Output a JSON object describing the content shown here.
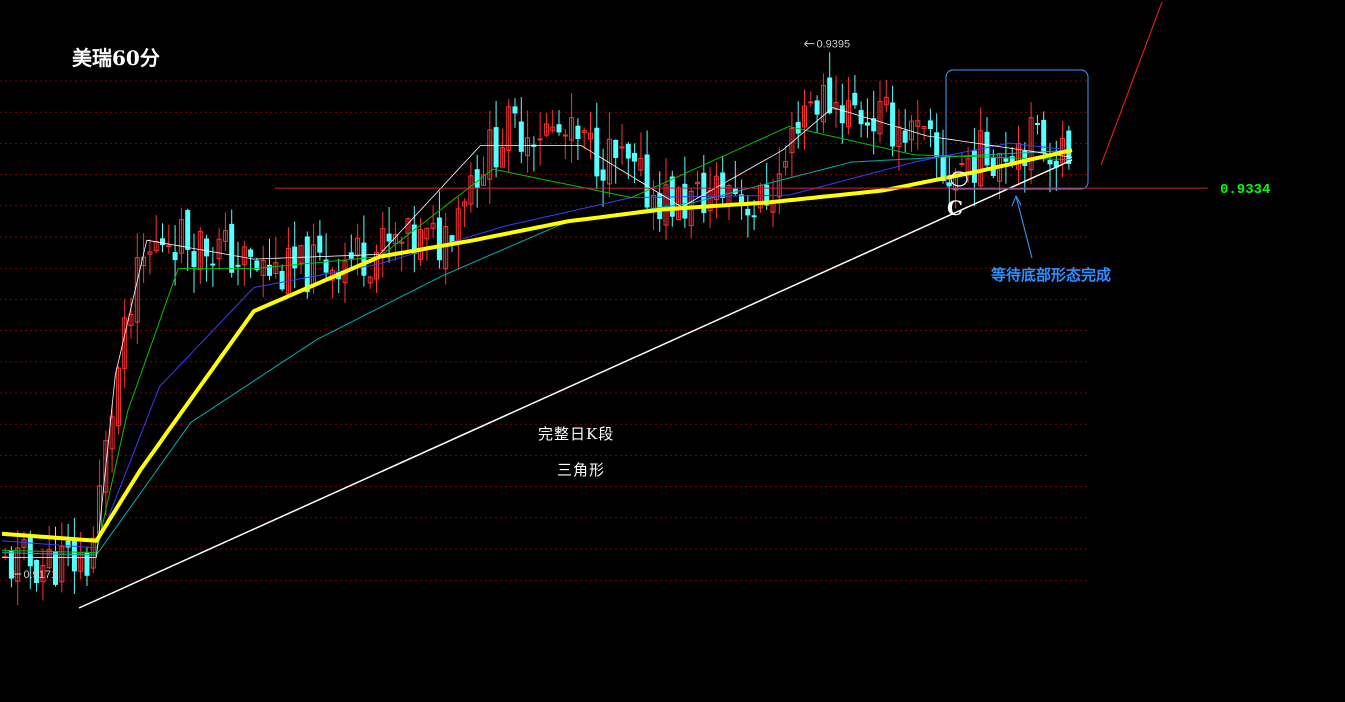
{
  "title": "美瑞60分",
  "annotations": {
    "wait_text": "等待底部形态完成",
    "main_text_1": "完整日K段",
    "main_text_2": "三角形",
    "point_label": "C"
  },
  "colors": {
    "background": "#000000",
    "up_candle": "#ff3030",
    "down_candle": "#54ffff",
    "grid": "#8b0000",
    "ma_main": "#ffff00",
    "ma_blue": "#3a3aff",
    "ma_green": "#00c000",
    "ma_cyan": "#00b0b0",
    "ma_white": "#ffffff",
    "trendline": "#ffffff",
    "level_line": "#cc2244",
    "level_label": "#00ff00",
    "wait_text": "#2e90ff",
    "box": "#3aa0ff",
    "red_line": "#ff2020"
  },
  "chart_data": {
    "type": "candlestick",
    "high_label": "0.9395",
    "low_label": "0.9171",
    "level_label": "0.9334",
    "high_value": 0.9395,
    "low_value": 0.9171,
    "level_value": 0.9334,
    "ylim": [
      0.916,
      0.9405
    ],
    "grid": true,
    "candle_count": 170,
    "close_path": [
      [
        0,
        0.9175
      ],
      [
        14,
        0.9177
      ],
      [
        15,
        0.9195
      ],
      [
        18,
        0.925
      ],
      [
        22,
        0.93
      ],
      [
        26,
        0.9315
      ],
      [
        30,
        0.9312
      ],
      [
        35,
        0.9308
      ],
      [
        40,
        0.93
      ],
      [
        46,
        0.9298
      ],
      [
        52,
        0.9303
      ],
      [
        58,
        0.9307
      ],
      [
        64,
        0.931
      ],
      [
        70,
        0.9312
      ],
      [
        74,
        0.9338
      ],
      [
        80,
        0.9358
      ],
      [
        85,
        0.936
      ],
      [
        92,
        0.9352
      ],
      [
        98,
        0.9345
      ],
      [
        103,
        0.9332
      ],
      [
        108,
        0.9327
      ],
      [
        116,
        0.9335
      ],
      [
        120,
        0.9325
      ],
      [
        124,
        0.934
      ],
      [
        127,
        0.937
      ],
      [
        131,
        0.9372
      ],
      [
        137,
        0.9365
      ],
      [
        143,
        0.936
      ],
      [
        147,
        0.9352
      ],
      [
        150,
        0.9338
      ],
      [
        153,
        0.9345
      ],
      [
        158,
        0.935
      ],
      [
        163,
        0.9355
      ],
      [
        167,
        0.9352
      ],
      [
        170,
        0.9345
      ]
    ],
    "ma_main": [
      [
        0,
        0.9188
      ],
      [
        15,
        0.9185
      ],
      [
        22,
        0.9215
      ],
      [
        40,
        0.9282
      ],
      [
        60,
        0.9305
      ],
      [
        75,
        0.9312
      ],
      [
        90,
        0.932
      ],
      [
        105,
        0.9325
      ],
      [
        122,
        0.9328
      ],
      [
        140,
        0.9333
      ],
      [
        155,
        0.9341
      ],
      [
        170,
        0.935
      ]
    ],
    "ma_blue": [
      [
        0,
        0.9185
      ],
      [
        15,
        0.9182
      ],
      [
        25,
        0.925
      ],
      [
        40,
        0.9292
      ],
      [
        60,
        0.9302
      ],
      [
        80,
        0.9318
      ],
      [
        100,
        0.933
      ],
      [
        125,
        0.9331
      ],
      [
        145,
        0.9345
      ],
      [
        160,
        0.9353
      ],
      [
        170,
        0.935
      ]
    ],
    "ma_green": [
      [
        0,
        0.9181
      ],
      [
        15,
        0.918
      ],
      [
        20,
        0.924
      ],
      [
        28,
        0.93
      ],
      [
        40,
        0.93
      ],
      [
        60,
        0.9305
      ],
      [
        78,
        0.9342
      ],
      [
        100,
        0.933
      ],
      [
        125,
        0.936
      ],
      [
        145,
        0.9348
      ],
      [
        170,
        0.9346
      ]
    ],
    "ma_cyan": [
      [
        0,
        0.918
      ],
      [
        15,
        0.9179
      ],
      [
        30,
        0.9235
      ],
      [
        50,
        0.927
      ],
      [
        70,
        0.9297
      ],
      [
        90,
        0.932
      ],
      [
        110,
        0.9328
      ],
      [
        135,
        0.9345
      ],
      [
        170,
        0.935
      ]
    ],
    "ma_white": [
      [
        0,
        0.9178
      ],
      [
        15,
        0.9178
      ],
      [
        18,
        0.9255
      ],
      [
        23,
        0.9312
      ],
      [
        40,
        0.9304
      ],
      [
        60,
        0.9306
      ],
      [
        76,
        0.9352
      ],
      [
        92,
        0.9352
      ],
      [
        108,
        0.9326
      ],
      [
        124,
        0.935
      ],
      [
        132,
        0.9368
      ],
      [
        147,
        0.9356
      ],
      [
        170,
        0.9347
      ]
    ]
  }
}
